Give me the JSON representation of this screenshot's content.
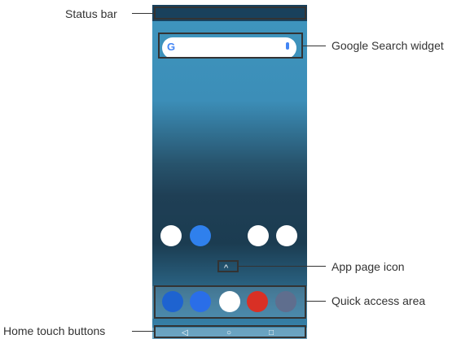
{
  "labels": {
    "status_bar": "Status bar",
    "google_search_widget": "Google Search widget",
    "app_page_icon": "App page icon",
    "quick_access_area": "Quick access area",
    "home_touch_buttons": "Home touch buttons"
  },
  "phone": {
    "search_logo": "G",
    "app_page_icon_glyph": "^",
    "nav": {
      "back": "◁",
      "home": "○",
      "recents": "□"
    }
  },
  "colors": {
    "callout": "#333333",
    "status_bar": "#19415c",
    "sea": "#3e94bd"
  },
  "icons": {
    "home_row": [
      "google-folder-icon",
      "duo-icon",
      "photos-icon",
      "play-store-icon"
    ],
    "dock": [
      "phone-icon",
      "messages-icon",
      "gmail-icon",
      "chrome-icon",
      "camera-icon"
    ]
  }
}
